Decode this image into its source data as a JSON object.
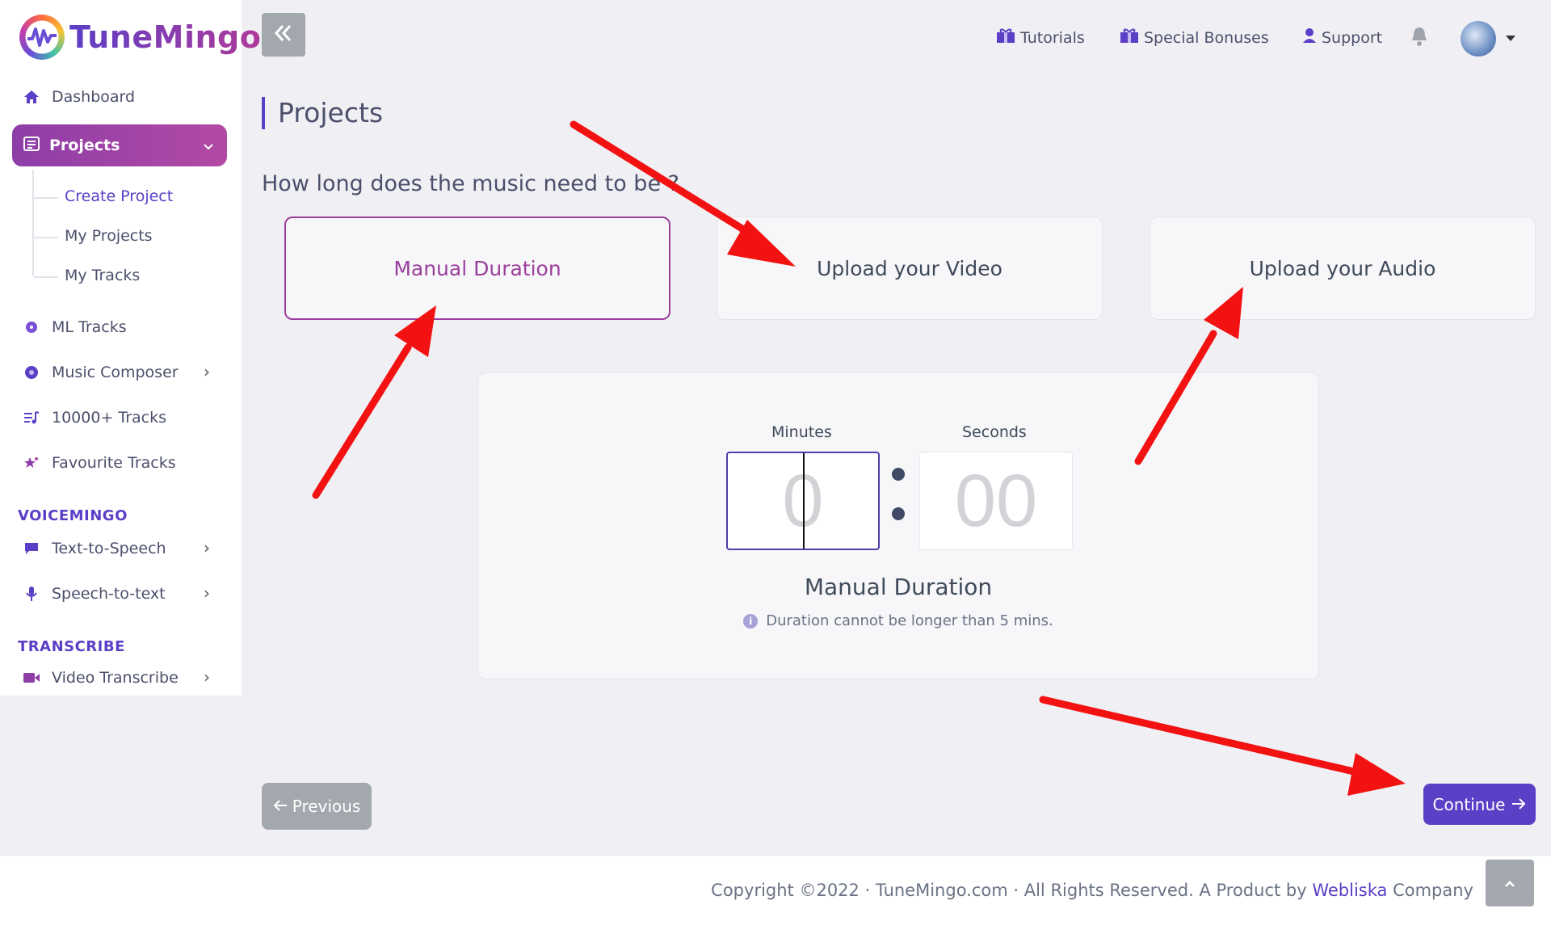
{
  "app": {
    "brand": "TuneMingo",
    "colors": {
      "accent": "#5b3fc6",
      "selected": "#9b3f9c",
      "arrow": "#f21212"
    }
  },
  "sidebar": {
    "dashboard": "Dashboard",
    "projects": "Projects",
    "submenu": [
      "Create Project",
      "My Projects",
      "My Tracks"
    ],
    "ml_tracks": "ML Tracks",
    "music_composer": "Music Composer",
    "tracks_10000": "10000+ Tracks",
    "favourite_tracks": "Favourite Tracks",
    "section_voicemingo": "VOICEMINGO",
    "text_to_speech": "Text-to-Speech",
    "speech_to_text": "Speech-to-text",
    "section_transcribe": "TRANSCRIBE",
    "video_transcribe": "Video Transcribe"
  },
  "topbar": {
    "tutorials": "Tutorials",
    "special_bonuses": "Special Bonuses",
    "support": "Support"
  },
  "page": {
    "title": "Projects",
    "question": "How long does the music need to be ?"
  },
  "options": {
    "manual": "Manual Duration",
    "video": "Upload your Video",
    "audio": "Upload your Audio",
    "selected": "manual"
  },
  "duration": {
    "minutes_label": "Minutes",
    "seconds_label": "Seconds",
    "minutes_placeholder": "0",
    "seconds_placeholder": "00",
    "title": "Manual Duration",
    "note": "Duration cannot be longer than 5 mins."
  },
  "buttons": {
    "previous": "Previous",
    "continue": "Continue"
  },
  "footer": {
    "copyright_pre": "Copyright ©2022 · TuneMingo.com · All Rights Reserved. A Product by ",
    "company_link": "Webliska",
    "copyright_post": " Company"
  }
}
